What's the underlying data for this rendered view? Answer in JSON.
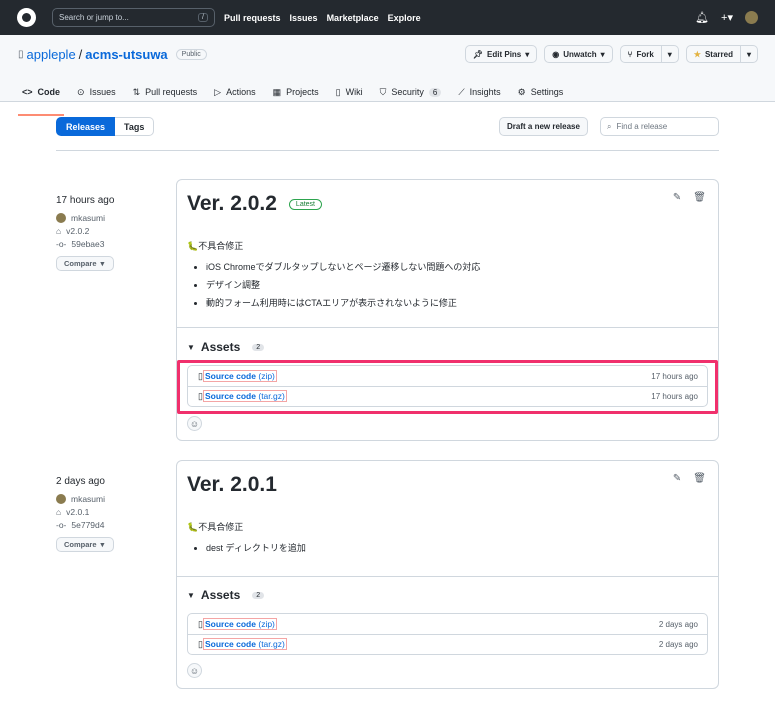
{
  "topbar": {
    "search_placeholder": "Search or jump to...",
    "search_key": "/",
    "nav": [
      "Pull requests",
      "Issues",
      "Marketplace",
      "Explore"
    ]
  },
  "repo": {
    "owner": "appleple",
    "name": "acms-utsuwa",
    "visibility": "Public",
    "edit_pins": "Edit Pins",
    "unwatch": "Unwatch",
    "fork": "Fork",
    "starred": "Starred"
  },
  "tabs": [
    {
      "label": "Code"
    },
    {
      "label": "Issues"
    },
    {
      "label": "Pull requests"
    },
    {
      "label": "Actions"
    },
    {
      "label": "Projects"
    },
    {
      "label": "Wiki"
    },
    {
      "label": "Security",
      "count": "6"
    },
    {
      "label": "Insights"
    },
    {
      "label": "Settings"
    }
  ],
  "subnav": {
    "releases": "Releases",
    "tags": "Tags",
    "draft": "Draft a new release",
    "find_placeholder": "Find a release"
  },
  "releases": [
    {
      "date": "17 hours ago",
      "author": "mkasumi",
      "tag": "v2.0.2",
      "commit": "59ebae3",
      "compare": "Compare",
      "title": "Ver. 2.0.2",
      "badge": "Latest",
      "heading": "🐛不具合修正",
      "items": [
        "iOS Chromeでダブルタップしないとページ遷移しない問題への対応",
        "デザイン調整",
        "動的フォーム利用時にはCTAエリアが表示されないように修正"
      ],
      "assets_label": "Assets",
      "assets_count": "2",
      "assets": [
        {
          "name": "Source code",
          "ext": "(zip)",
          "time": "17 hours ago"
        },
        {
          "name": "Source code",
          "ext": "(tar.gz)",
          "time": "17 hours ago"
        }
      ]
    },
    {
      "date": "2 days ago",
      "author": "mkasumi",
      "tag": "v2.0.1",
      "commit": "5e779d4",
      "compare": "Compare",
      "title": "Ver. 2.0.1",
      "heading": "🐛不具合修正",
      "items": [
        "dest ディレクトリを追加"
      ],
      "assets_label": "Assets",
      "assets_count": "2",
      "assets": [
        {
          "name": "Source code",
          "ext": "(zip)",
          "time": "2 days ago"
        },
        {
          "name": "Source code",
          "ext": "(tar.gz)",
          "time": "2 days ago"
        }
      ]
    }
  ]
}
